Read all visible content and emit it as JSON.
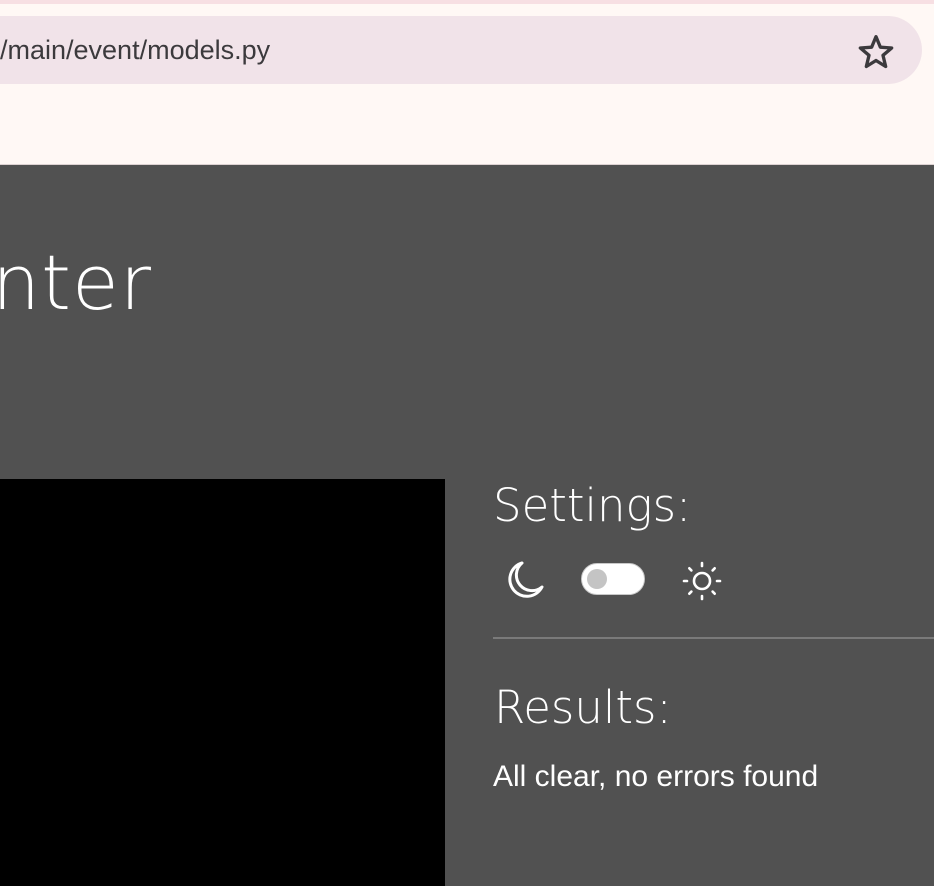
{
  "browser": {
    "address": "/main/event/models.py",
    "bookmark_icon": "star-icon"
  },
  "page": {
    "title": "nter",
    "colors": {
      "background": "#515151",
      "panel": "#000000",
      "text": "#ffffff"
    }
  },
  "settings": {
    "title": "Settings:",
    "dark_icon": "moon-icon",
    "light_icon": "sun-icon",
    "theme_toggle_on": false
  },
  "results": {
    "title": "Results:",
    "message": "All clear, no errors found"
  }
}
